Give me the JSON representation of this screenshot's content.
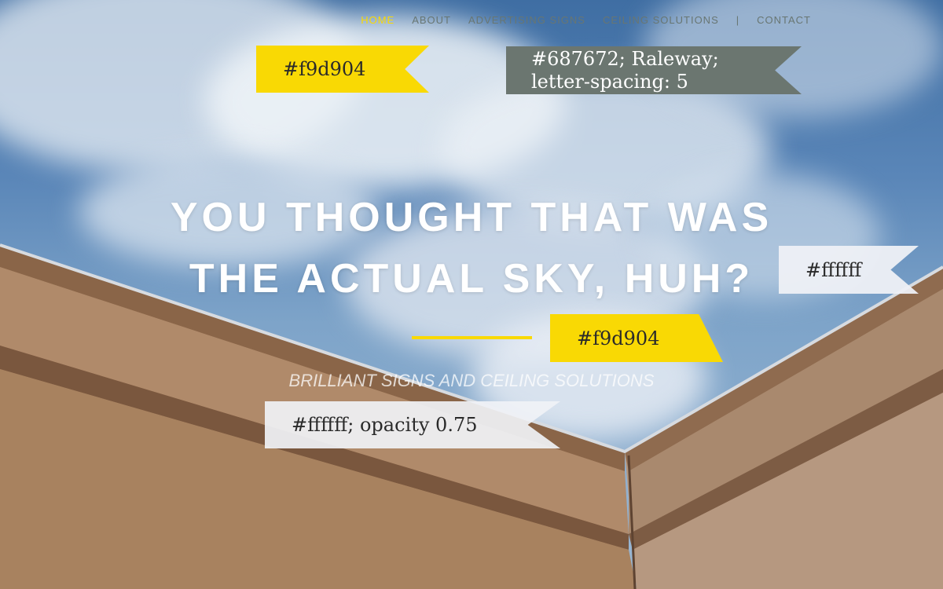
{
  "nav": {
    "items": [
      {
        "label": "HOME",
        "active": true
      },
      {
        "label": "ABOUT",
        "active": false
      },
      {
        "label": "ADVERTISING SIGNS",
        "active": false
      },
      {
        "label": "CEILING SOLUTIONS",
        "active": false
      }
    ],
    "separator": "|",
    "contact": "CONTACT"
  },
  "hero": {
    "title_line1": "YOU THOUGHT THAT WAS",
    "title_line2": "THE ACTUAL SKY, HUH?",
    "subtitle": "BRILLIANT SIGNS AND CEILING SOLUTIONS"
  },
  "annotations": {
    "nav_active_color": "#f9d904",
    "nav_style_line1": "#687672; Raleway;",
    "nav_style_line2": "letter-spacing: 5",
    "title_color": "#ffffff",
    "rule_color": "#f9d904",
    "subtitle_style": "#ffffff; opacity 0.75"
  },
  "colors": {
    "accent": "#f9d904",
    "nav_text": "#687672",
    "title": "#ffffff"
  }
}
